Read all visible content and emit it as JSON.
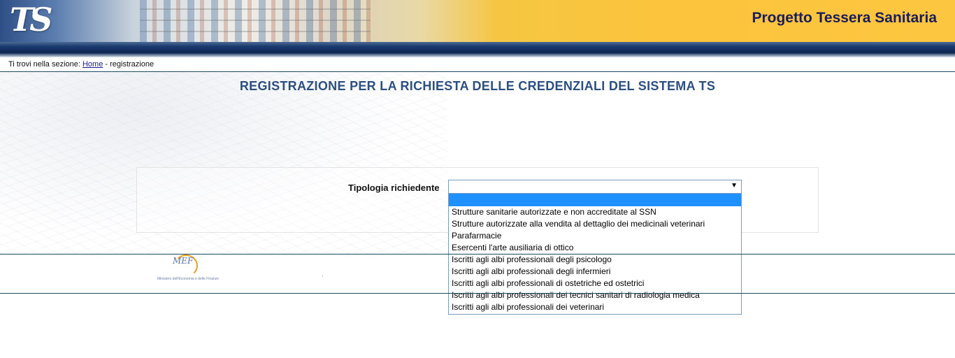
{
  "header": {
    "logo_text": "TS",
    "title": "Progetto Tessera Sanitaria"
  },
  "breadcrumb": {
    "prefix": "Ti trovi nella sezione:",
    "home_link": "Home",
    "separator": "-",
    "current": "registrazione"
  },
  "page": {
    "title": "REGISTRAZIONE PER LA RICHIESTA DELLE CREDENZIALI DEL SISTEMA TS"
  },
  "form": {
    "label": "Tipologia richiedente",
    "selected_value": "",
    "options": [
      "",
      "Strutture sanitarie autorizzate e non accreditate al SSN",
      "Strutture autorizzate alla vendita al dettaglio dei medicinali veterinari",
      "Parafarmacie",
      "Esercenti l'arte ausiliaria di ottico",
      "Iscritti agli albi professionali degli psicologo",
      "Iscritti agli albi professionali degli infermieri",
      "Iscritti agli albi professionali di ostetriche ed ostetrici",
      "Iscritti agli albi professionali dei tecnici sanitari di radiologia medica",
      "Iscritti agli albi professionali dei veterinari"
    ]
  },
  "footer": {
    "logo_text": "MEF",
    "ministry": "Ministero dell'Economia e delle Finanze"
  },
  "colors": {
    "title_color": "#2d4f80",
    "banner_title_color": "#1c1c58",
    "selection_highlight": "#1e90ff"
  }
}
